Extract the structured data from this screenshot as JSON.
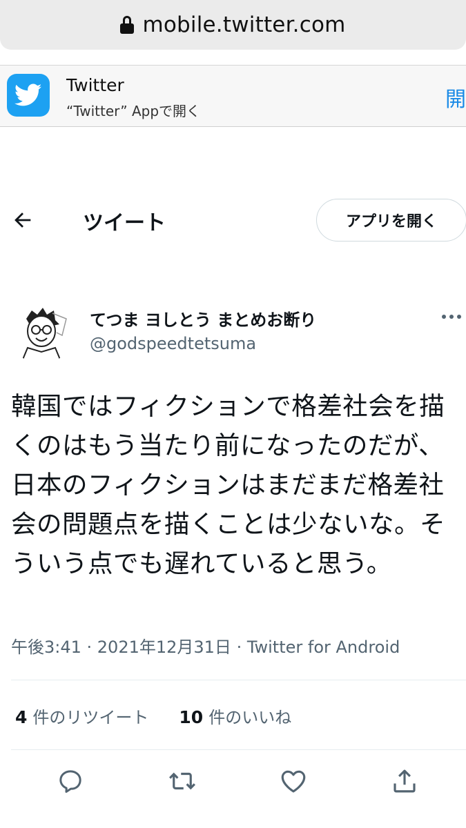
{
  "browser": {
    "url": "mobile.twitter.com"
  },
  "app_banner": {
    "app_name": "Twitter",
    "subtitle": "“Twitter” Appで開く",
    "open_label": "開"
  },
  "header": {
    "title": "ツイート",
    "open_app_label": "アプリを開く"
  },
  "tweet": {
    "display_name": "てつま ヨしとう まとめお断り",
    "handle": "@godspeedtetsuma",
    "text": "韓国ではフィクションで格差社会を描くのはもう当たり前になったのだが、日本のフィクションはまだまだ格差社会の問題点を描くことは少ないな。そういう点でも遅れていると思う。",
    "meta": "午後3:41 · 2021年12月31日 · Twitter for Android",
    "retweets": {
      "count": "4",
      "label": "件のリツイート"
    },
    "likes": {
      "count": "10",
      "label": "件のいいね"
    }
  },
  "icons": {
    "lock": "lock-icon",
    "app": "twitter-bird-icon",
    "back": "back-arrow-icon",
    "more": "more-icon",
    "reply": "reply-icon",
    "retweet": "retweet-icon",
    "like": "like-icon",
    "share": "share-icon"
  },
  "colors": {
    "brand": "#1da1f2",
    "text": "#0f1419",
    "secondary": "#536471",
    "banner_link": "#1a8ae6"
  }
}
